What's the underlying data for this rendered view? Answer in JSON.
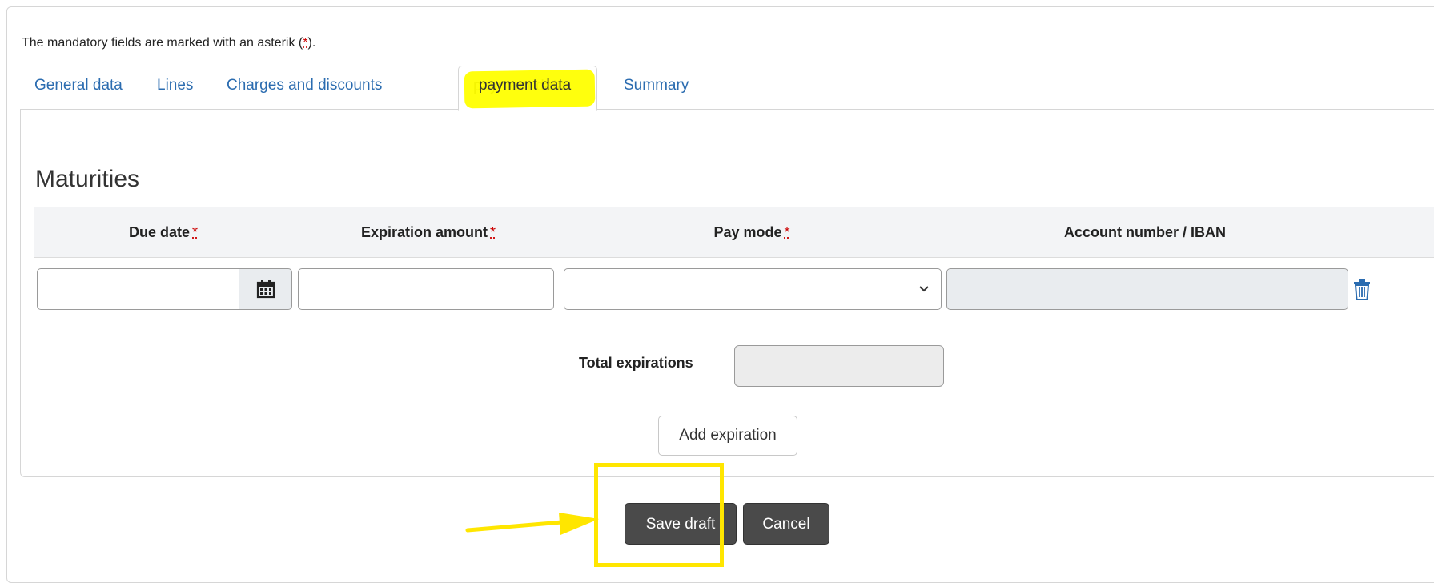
{
  "form": {
    "note_text": "The mandatory fields are marked with an asterik (",
    "note_asterisk": "*",
    "note_end": ")."
  },
  "tabs": [
    {
      "label": "General data",
      "active": false
    },
    {
      "label": "Lines",
      "active": false
    },
    {
      "label": "Charges and discounts",
      "active": false
    },
    {
      "label": "payment data",
      "active": true
    },
    {
      "label": "Summary",
      "active": false
    }
  ],
  "maturities": {
    "title": "Maturities",
    "columns": [
      {
        "label": "Due date",
        "required": "*"
      },
      {
        "label": "Expiration amount",
        "required": "*"
      },
      {
        "label": "Pay mode",
        "required": "*"
      },
      {
        "label": "Account number / IBAN",
        "required": ""
      }
    ],
    "row": {
      "due_date": "",
      "expiration_amount": "",
      "pay_mode": "",
      "account_number": ""
    },
    "total_label": "Total expirations",
    "total_value": "",
    "add_button": "Add expiration"
  },
  "actions": {
    "save_draft": "Save draft",
    "cancel": "Cancel"
  },
  "colors": {
    "link": "#2b6cb0",
    "required": "#cc0000",
    "highlight": "#ffff00",
    "button": "#4a4a4a"
  },
  "icons": [
    "calendar-icon",
    "chevron-down-icon",
    "trash-icon",
    "arrow-icon"
  ]
}
